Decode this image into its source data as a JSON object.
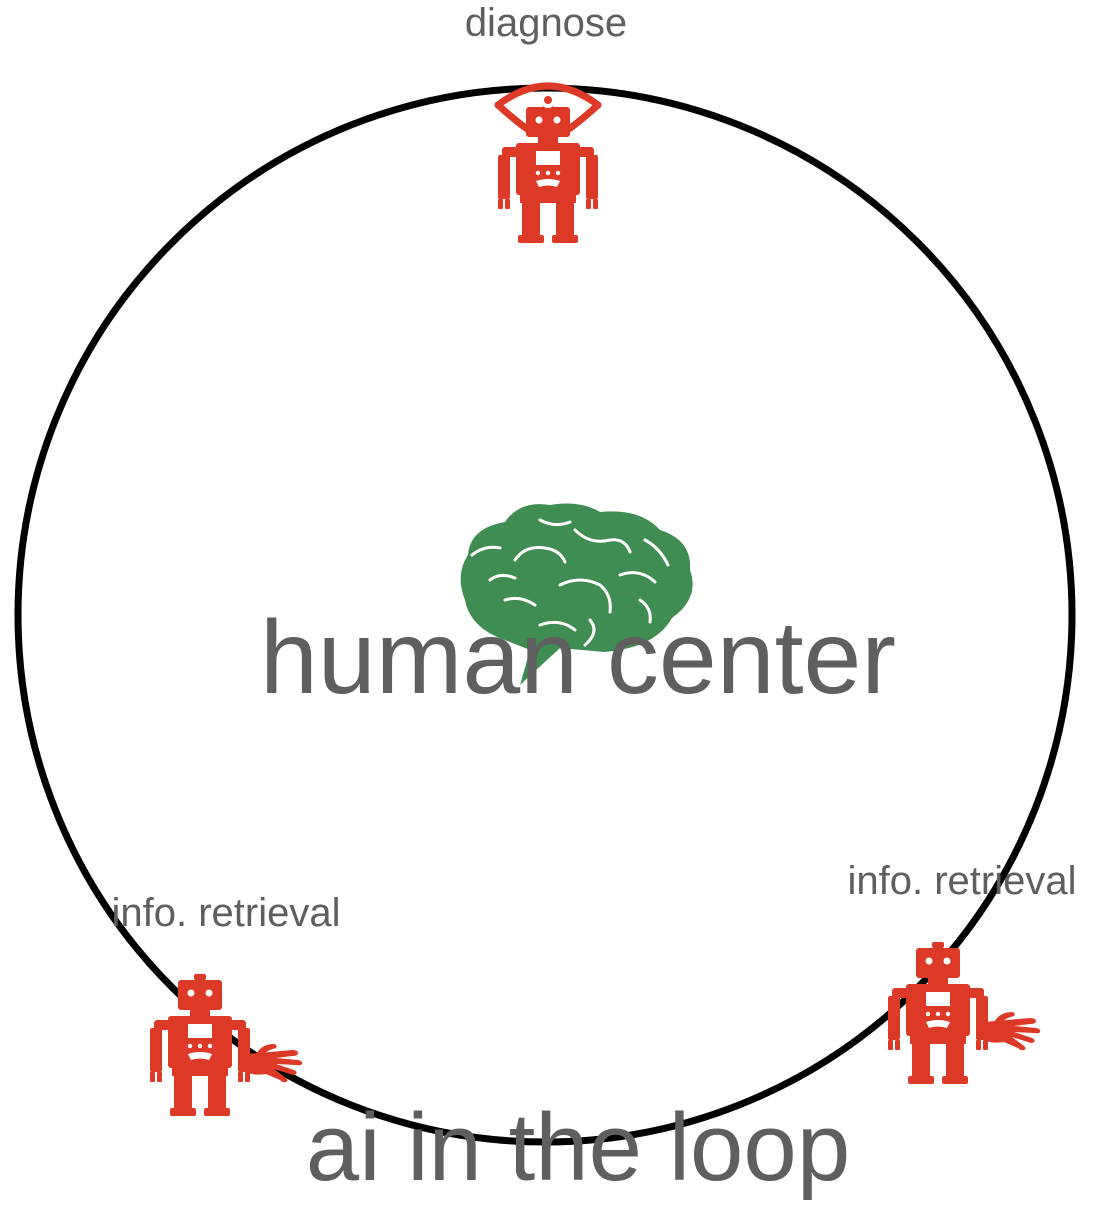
{
  "diagram": {
    "center_label": "human center",
    "loop_label": "ai in the loop",
    "nodes": [
      {
        "label": "diagnose",
        "icon": "robot-eye-icon"
      },
      {
        "label": "info. retrieval",
        "icon": "robot-hand-icon"
      },
      {
        "label": "info. retrieval",
        "icon": "robot-hand-icon"
      }
    ],
    "center_icon": "brain-icon"
  },
  "colors": {
    "robot": "#dc3a26",
    "brain": "#3f8d52",
    "text": "#5f5f5f",
    "loop": "#000000"
  }
}
